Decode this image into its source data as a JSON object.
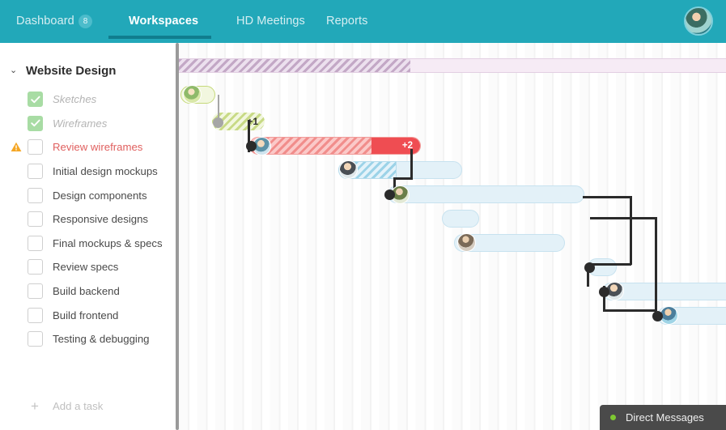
{
  "nav": {
    "dashboard": "Dashboard",
    "dashboard_badge": "8",
    "workspaces": "Workspaces",
    "meetings": "HD Meetings",
    "reports": "Reports",
    "active": "Workspaces",
    "accent_color": "#22a8b9",
    "active_underline_color": "#107d8e"
  },
  "sidebar": {
    "group_title": "Website Design",
    "chevron": "⌄",
    "add_task_label": "Add a task",
    "add_task_plus": "+",
    "tasks": [
      {
        "label": "Sketches",
        "state": "done",
        "warning": false
      },
      {
        "label": "Wireframes",
        "state": "done",
        "warning": false
      },
      {
        "label": "Review wireframes",
        "state": "open",
        "warning": true
      },
      {
        "label": "Initial design mockups",
        "state": "open",
        "warning": false
      },
      {
        "label": "Design components",
        "state": "open",
        "warning": false
      },
      {
        "label": "Responsive designs",
        "state": "open",
        "warning": false
      },
      {
        "label": "Final mockups & specs",
        "state": "open",
        "warning": false
      },
      {
        "label": "Review specs",
        "state": "open",
        "warning": false
      },
      {
        "label": "Build backend",
        "state": "open",
        "warning": false
      },
      {
        "label": "Build frontend",
        "state": "open",
        "warning": false
      },
      {
        "label": "Testing & debugging",
        "state": "open",
        "warning": false
      }
    ]
  },
  "gantt": {
    "summary": {
      "label": "",
      "progress_pct": 42,
      "color": "#e8dcea"
    },
    "bars": [
      {
        "task": "Sketches",
        "style": "green",
        "extra": ""
      },
      {
        "task": "Wireframes",
        "style": "green-hatch",
        "extra": "+1"
      },
      {
        "task": "Review wireframes",
        "style": "red",
        "extra": "+2"
      },
      {
        "task": "Initial design mockups",
        "style": "blue-hatch",
        "extra": ""
      },
      {
        "task": "Design components",
        "style": "blue",
        "extra": ""
      },
      {
        "task": "Responsive designs",
        "style": "blue",
        "extra": ""
      },
      {
        "task": "Final mockups & specs",
        "style": "blue",
        "extra": ""
      },
      {
        "task": "Review specs",
        "style": "blue",
        "extra": ""
      },
      {
        "task": "Build backend",
        "style": "blue",
        "extra": ""
      },
      {
        "task": "Build frontend",
        "style": "blue",
        "extra": ""
      }
    ]
  },
  "direct_messages": {
    "label": "Direct Messages",
    "status": "online",
    "status_color": "#7ec832"
  }
}
